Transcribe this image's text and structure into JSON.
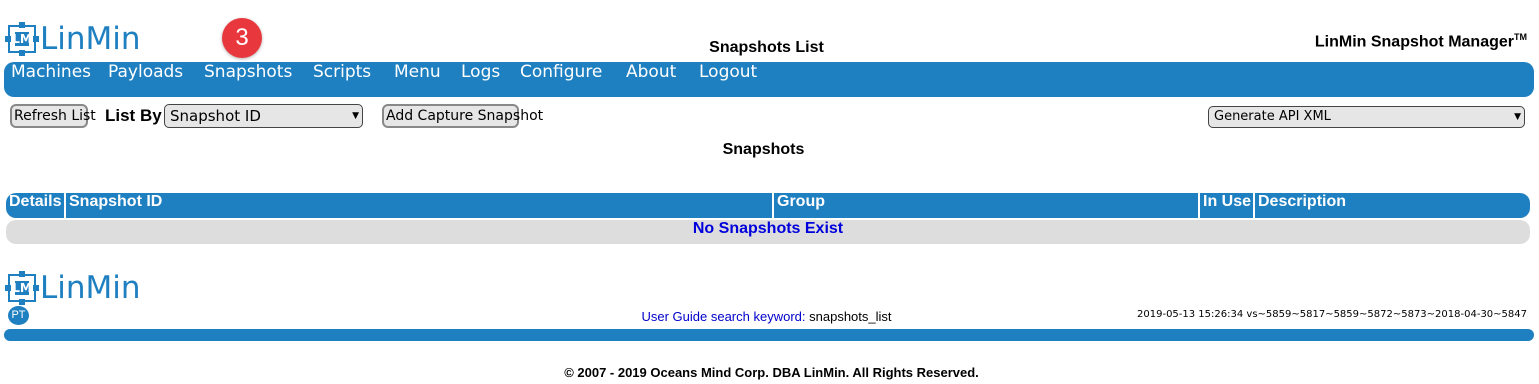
{
  "header": {
    "logo_text": "LinMin",
    "logo_mark_letter": "LM",
    "step_badge": "3",
    "page_title": "Snapshots List",
    "product_name": "LinMin Snapshot Manager",
    "product_tm": "TM"
  },
  "nav": {
    "items": [
      {
        "label": "Machines"
      },
      {
        "label": "Payloads"
      },
      {
        "label": "Snapshots"
      },
      {
        "label": "Scripts"
      },
      {
        "label": "Menu"
      },
      {
        "label": "Logs"
      },
      {
        "label": "Configure"
      },
      {
        "label": "About"
      },
      {
        "label": "Logout"
      }
    ]
  },
  "toolbar": {
    "refresh_label": "Refresh List",
    "list_by_label": "List By",
    "list_by_selected": "Snapshot ID",
    "add_capture_label": "Add Capture Snapshot",
    "api_select_selected": "Generate API XML"
  },
  "section_title": "Snapshots",
  "table": {
    "columns": [
      "Details",
      "Snapshot ID",
      "Group",
      "In Use",
      "Description"
    ],
    "empty_message": "No Snapshots Exist"
  },
  "footer": {
    "logo_text": "LinMin",
    "pt_badge": "PT",
    "guide_label": "User Guide search keyword:",
    "guide_keyword": "snapshots_list",
    "version": "2019-05-13 15:26:34 vs~5859~5817~5859~5872~5873~2018-04-30~5847",
    "copyright": "© 2007 - 2019 Oceans Mind Corp. DBA LinMin. All Rights Reserved."
  },
  "colors": {
    "brand_blue": "#1e7fc1",
    "badge_red": "#e8383d",
    "empty_text_blue": "#0000dd",
    "row_gray": "#dddddd"
  }
}
